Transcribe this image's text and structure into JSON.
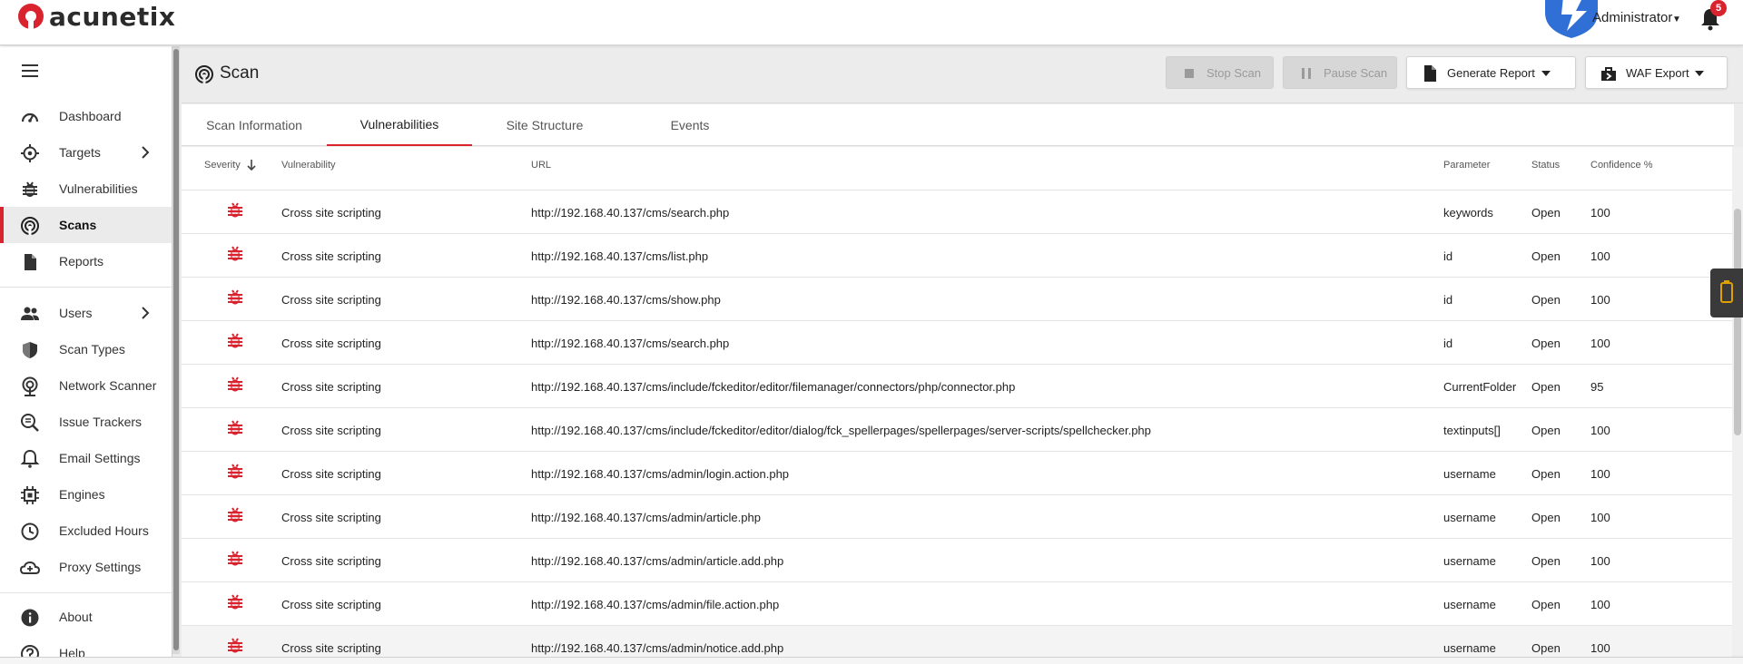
{
  "app": {
    "logo_text": "acunetix",
    "user_name": "Administrator",
    "notification_count": "5",
    "brand_color": "#d9232e"
  },
  "sidebar": {
    "items": [
      {
        "label": "Dashboard",
        "icon": "dashboard-icon"
      },
      {
        "label": "Targets",
        "icon": "target-icon",
        "has_submenu": true
      },
      {
        "label": "Vulnerabilities",
        "icon": "bug-icon"
      },
      {
        "label": "Scans",
        "icon": "scan-icon",
        "active": true
      },
      {
        "label": "Reports",
        "icon": "report-icon"
      },
      {
        "label": "Users",
        "icon": "users-icon",
        "has_submenu": true
      },
      {
        "label": "Scan Types",
        "icon": "shield-icon"
      },
      {
        "label": "Network Scanner",
        "icon": "network-scanner-icon"
      },
      {
        "label": "Issue Trackers",
        "icon": "issue-tracker-icon"
      },
      {
        "label": "Email Settings",
        "icon": "bell-icon"
      },
      {
        "label": "Engines",
        "icon": "engine-icon"
      },
      {
        "label": "Excluded Hours",
        "icon": "clock-icon"
      },
      {
        "label": "Proxy Settings",
        "icon": "cloud-icon"
      },
      {
        "label": "About",
        "icon": "info-icon"
      },
      {
        "label": "Help",
        "icon": "help-icon"
      }
    ]
  },
  "page": {
    "title": "Scan",
    "buttons": {
      "stop": "Stop Scan",
      "pause": "Pause Scan",
      "generate_report": "Generate Report",
      "waf_export": "WAF Export"
    }
  },
  "tabs": [
    {
      "label": "Scan Information"
    },
    {
      "label": "Vulnerabilities",
      "active": true
    },
    {
      "label": "Site Structure"
    },
    {
      "label": "Events"
    }
  ],
  "table": {
    "columns": {
      "severity": "Severity",
      "vulnerability": "Vulnerability",
      "url": "URL",
      "parameter": "Parameter",
      "status": "Status",
      "confidence": "Confidence %"
    },
    "rows": [
      {
        "vulnerability": "Cross site scripting",
        "url": "http://192.168.40.137/cms/search.php",
        "parameter": "keywords",
        "status": "Open",
        "confidence": "100"
      },
      {
        "vulnerability": "Cross site scripting",
        "url": "http://192.168.40.137/cms/list.php",
        "parameter": "id",
        "status": "Open",
        "confidence": "100"
      },
      {
        "vulnerability": "Cross site scripting",
        "url": "http://192.168.40.137/cms/show.php",
        "parameter": "id",
        "status": "Open",
        "confidence": "100"
      },
      {
        "vulnerability": "Cross site scripting",
        "url": "http://192.168.40.137/cms/search.php",
        "parameter": "id",
        "status": "Open",
        "confidence": "100"
      },
      {
        "vulnerability": "Cross site scripting",
        "url": "http://192.168.40.137/cms/include/fckeditor/editor/filemanager/connectors/php/connector.php",
        "parameter": "CurrentFolder",
        "status": "Open",
        "confidence": "95"
      },
      {
        "vulnerability": "Cross site scripting",
        "url": "http://192.168.40.137/cms/include/fckeditor/editor/dialog/fck_spellerpages/spellerpages/server-scripts/spellchecker.php",
        "parameter": "textinputs[]",
        "status": "Open",
        "confidence": "100"
      },
      {
        "vulnerability": "Cross site scripting",
        "url": "http://192.168.40.137/cms/admin/login.action.php",
        "parameter": "username",
        "status": "Open",
        "confidence": "100"
      },
      {
        "vulnerability": "Cross site scripting",
        "url": "http://192.168.40.137/cms/admin/article.php",
        "parameter": "username",
        "status": "Open",
        "confidence": "100"
      },
      {
        "vulnerability": "Cross site scripting",
        "url": "http://192.168.40.137/cms/admin/article.add.php",
        "parameter": "username",
        "status": "Open",
        "confidence": "100"
      },
      {
        "vulnerability": "Cross site scripting",
        "url": "http://192.168.40.137/cms/admin/file.action.php",
        "parameter": "username",
        "status": "Open",
        "confidence": "100"
      },
      {
        "vulnerability": "Cross site scripting",
        "url": "http://192.168.40.137/cms/admin/notice.add.php",
        "parameter": "username",
        "status": "Open",
        "confidence": "100"
      }
    ]
  }
}
